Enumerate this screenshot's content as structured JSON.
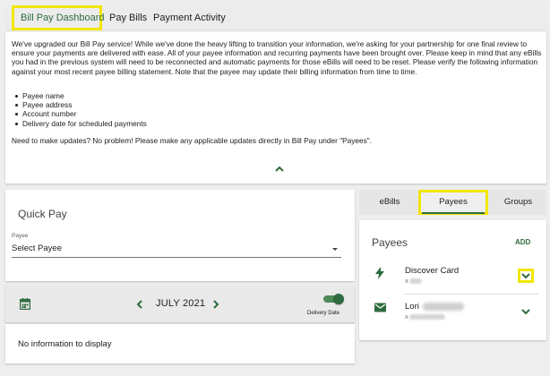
{
  "top_tabs": [
    "Bill Pay Dashboard",
    "Pay Bills",
    "Payment Activity"
  ],
  "notice": {
    "intro": "We've upgraded our Bill Pay service! While we've done the heavy lifting to transition your information, we're asking for your partnership for one final review to ensure your payments are delivered with ease. All of your payee information and recurring payments have been brought over. Please keep in mind that any eBills you had in the previous system will need to be reconnected and automatic payments for those eBills will need to be reset. Please verify the following information against your most recent payee billing statement. Note that the payee may update their billing information from time to time.",
    "items": [
      "Payee name",
      "Payee address",
      "Account number",
      "Delivery date for scheduled payments"
    ],
    "update": "Need to make updates? No problem! Please make any applicable updates directly in Bill Pay under \"Payees\"."
  },
  "quick_pay": {
    "title": "Quick Pay",
    "payee_label": "Payee",
    "payee_value": "Select Payee"
  },
  "date_bar": {
    "month": "JULY 2021",
    "toggle_label": "Delivery Date",
    "toggle_on": true
  },
  "empty_state": "No information to display",
  "right_tabs": [
    "eBills",
    "Payees",
    "Groups"
  ],
  "payees": {
    "title": "Payees",
    "add_label": "ADD",
    "items": [
      {
        "name": "Discover Card",
        "account": "x",
        "icon": "bolt-icon"
      },
      {
        "name": "Lori",
        "account": "x",
        "icon": "envelope-icon"
      }
    ]
  },
  "colors": {
    "accent": "#2e6b3e",
    "highlight": "#f2e600",
    "background": "#eeeeee"
  }
}
